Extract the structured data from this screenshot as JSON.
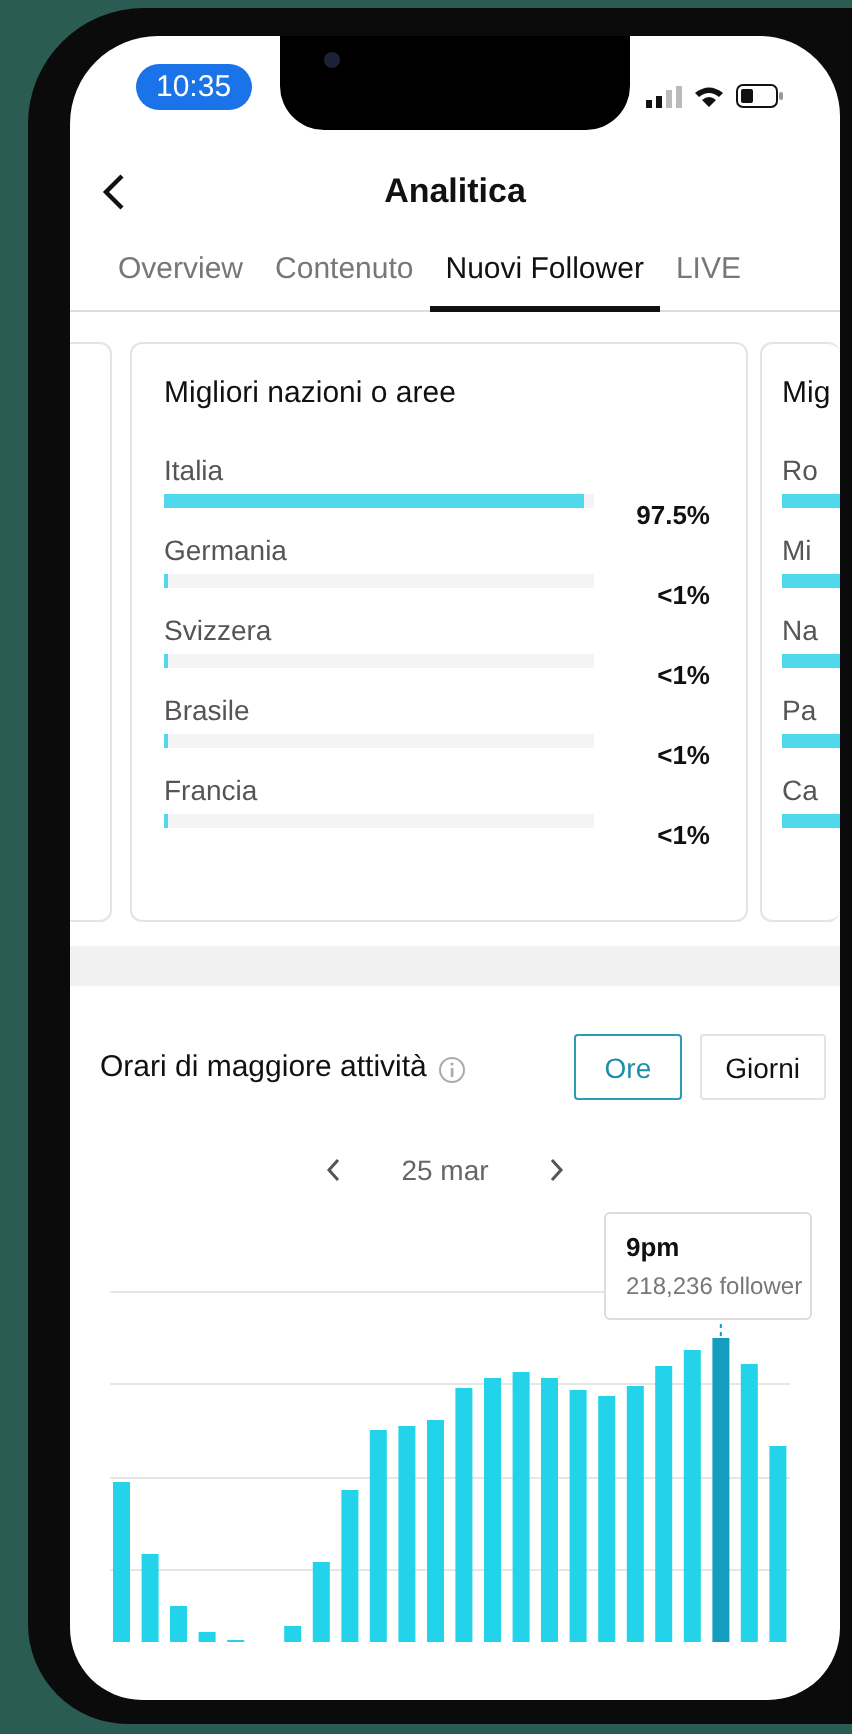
{
  "status_bar": {
    "time": "10:35"
  },
  "header": {
    "title": "Analitica"
  },
  "tabs": [
    {
      "label": "Overview",
      "selected": false
    },
    {
      "label": "Contenuto",
      "selected": false
    },
    {
      "label": "Nuovi Follower",
      "selected": true
    },
    {
      "label": "LIVE",
      "selected": false
    }
  ],
  "country_card": {
    "title": "Migliori nazioni o aree",
    "items": [
      {
        "name": "Italia",
        "level": 0.975,
        "value": "97.5%"
      },
      {
        "name": "Germania",
        "level": 0.008,
        "value": "<1%"
      },
      {
        "name": "Svizzera",
        "level": 0.008,
        "value": "<1%"
      },
      {
        "name": "Brasile",
        "level": 0.004,
        "value": "<1%"
      },
      {
        "name": "Francia",
        "level": 0.004,
        "value": "<1%"
      }
    ]
  },
  "next_card": {
    "title": "Mig",
    "items": [
      "Ro",
      "Mi",
      "Na",
      "Pa",
      "Ca"
    ]
  },
  "activity": {
    "title": "Orari di maggiore attività",
    "toggles": [
      {
        "label": "Ore",
        "selected": true
      },
      {
        "label": "Giorni",
        "selected": false
      }
    ],
    "date": "25 mar",
    "tooltip": {
      "time": "9pm",
      "value": "218,236 follower"
    }
  }
}
